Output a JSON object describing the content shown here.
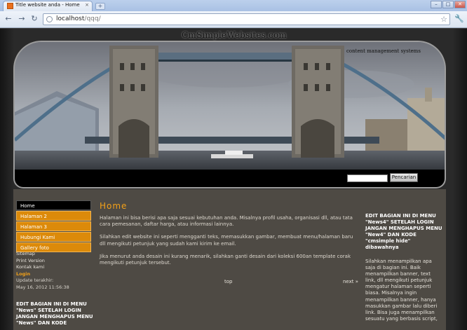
{
  "browser": {
    "tab_title": "Title website anda - Home",
    "tab_close": "×",
    "new_tab": "+",
    "url_host": "localhost",
    "url_path": "/qqq/",
    "win_minimize": "–",
    "win_maximize": "□",
    "win_close": "✕"
  },
  "site": {
    "logo": "CmSimpleWebsites.com",
    "tagline": "content management systems",
    "search_button": "Pencarian"
  },
  "menu": {
    "items": [
      {
        "label": "Home",
        "active": true
      },
      {
        "label": "Halaman 2"
      },
      {
        "label": "Halaman 3"
      },
      {
        "label": "Hubungi Kami"
      },
      {
        "label": "Gallery foto"
      }
    ],
    "links": [
      "Sitemap",
      "Print Version",
      "Kontak kami"
    ],
    "login": "Login",
    "update_label": "Update terakhir:",
    "update_date": "May 16, 2012 11:56:38",
    "left_note": "EDIT BAGIAN INI DI MENU \"News\" SETELAH LOGIN JANGAN MENGHAPUS MENU \"News\" DAN KODE"
  },
  "main": {
    "title": "Home",
    "paragraphs": [
      "Halaman ini bisa berisi apa saja sesuai kebutuhan anda. Misalnya profil usaha, organisasi dll, atau tata cara pemesanan, daftar harga, atau informasi lainnya.",
      "Silahkan edit website ini seperti mengganti teks, memasukkan gambar, membuat menu/halaman baru dll mengikuti petunjuk yang sudah kami kirim ke email.",
      "Jika menurut anda desain ini kurang menarik, silahkan ganti desain dari koleksi 600an template corak mengikuti petunjuk tersebut."
    ],
    "pager_top": "top",
    "pager_next": "next »"
  },
  "right": {
    "title": "EDIT BAGIAN INI DI MENU \"News4\" SETELAH LOGIN JANGAN MENGHAPUS MENU \"New4\" DAN KODE \"cmsimple hide\" dibawahnya",
    "text": "Silahkan menampilkan apa saja di bagian ini. Baik menampilkan banner, text link, dll mengikuti petunjuk mengatur halaman seperti biasa. Misalnya ingin menampilkan banner, hanya masukkan gambar lalu diberi link. Bisa juga menampilkan sesuatu yang berbasis script,"
  },
  "colors": {
    "accent": "#dc8a0a",
    "heading": "#f2a018",
    "content_bg": "#4e4a44"
  },
  "icons": [
    "back-icon",
    "forward-icon",
    "reload-icon",
    "page-icon",
    "star-icon",
    "wrench-icon"
  ]
}
